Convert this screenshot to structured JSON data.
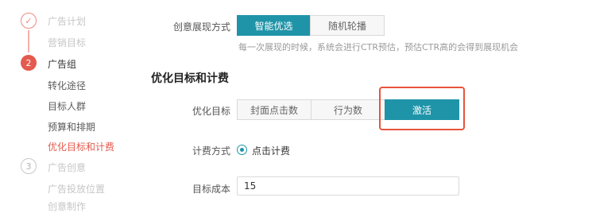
{
  "sidebar": {
    "steps": [
      {
        "number": "✓",
        "label": "广告计划",
        "items": [
          "营销目标"
        ]
      },
      {
        "number": "2",
        "label": "广告组",
        "items": [
          "转化途径",
          "目标人群",
          "预算和排期",
          "优化目标和计费"
        ],
        "current_item": "优化目标和计费"
      },
      {
        "number": "3",
        "label": "广告创意",
        "items": [
          "广告投放位置",
          "创意制作"
        ]
      }
    ]
  },
  "creative_display": {
    "label": "创意展现方式",
    "options": [
      "智能优选",
      "随机轮播"
    ],
    "selected": "智能优选",
    "hint": "每一次展现的时候，系统会进行CTR预估，预估CTR高的会得到展现机会"
  },
  "optimization": {
    "section_title": "优化目标和计费",
    "goal_label": "优化目标",
    "goal_options": [
      "封面点击数",
      "行为数",
      "激活"
    ],
    "goal_selected": "激活",
    "billing_label": "计费方式",
    "billing_option": "点击计费",
    "cost_label": "目标成本",
    "cost_value": "15"
  },
  "colors": {
    "accent": "#1f94a8",
    "step_active": "#e45a4e",
    "highlight_box": "#e8533b"
  }
}
